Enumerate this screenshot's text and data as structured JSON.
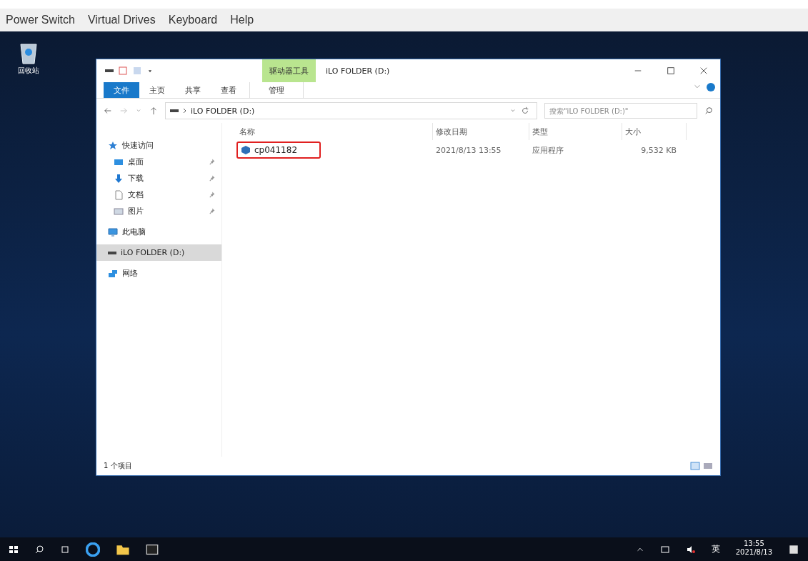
{
  "menu_bar": {
    "items": [
      "Power Switch",
      "Virtual Drives",
      "Keyboard",
      "Help"
    ]
  },
  "desktop": {
    "icons": [
      {
        "label": "回收站"
      }
    ]
  },
  "explorer": {
    "title": "iLO FOLDER (D:)",
    "context_tab": "驱动器工具",
    "ribbon_tabs": [
      {
        "label": "文件",
        "selected": true,
        "kind": "file"
      },
      {
        "label": "主页",
        "selected": false,
        "kind": "tab"
      },
      {
        "label": "共享",
        "selected": false,
        "kind": "tab"
      },
      {
        "label": "查看",
        "selected": false,
        "kind": "tab"
      },
      {
        "label": "管理",
        "selected": false,
        "kind": "context"
      }
    ],
    "address": "iLO FOLDER (D:)",
    "search": {
      "placeholder": "搜索\"iLO FOLDER (D:)\""
    },
    "sidebar": {
      "items": [
        {
          "label": "快速访问",
          "kind": "star",
          "selected": false,
          "children": [
            {
              "label": "桌面",
              "kind": "desktop",
              "pinned": true,
              "selected": false
            },
            {
              "label": "下载",
              "kind": "download",
              "pinned": true,
              "selected": false
            },
            {
              "label": "文档",
              "kind": "document",
              "pinned": true,
              "selected": false
            },
            {
              "label": "图片",
              "kind": "picture",
              "pinned": true,
              "selected": false
            }
          ]
        },
        {
          "label": "此电脑",
          "kind": "computer",
          "selected": false
        },
        {
          "label": "iLO FOLDER (D:)",
          "kind": "drive",
          "selected": true
        },
        {
          "label": "网络",
          "kind": "network",
          "selected": false
        }
      ]
    },
    "columns": [
      "名称",
      "修改日期",
      "类型",
      "大小"
    ],
    "rows": [
      {
        "name": "cp041182",
        "date": "2021/8/13 13:55",
        "type": "应用程序",
        "size": "9,532 KB",
        "highlighted": true
      }
    ],
    "status": "1 个项目"
  },
  "taskbar": {
    "tray": {
      "ime": "英",
      "time": "13:55",
      "date": "2021/8/13"
    }
  }
}
